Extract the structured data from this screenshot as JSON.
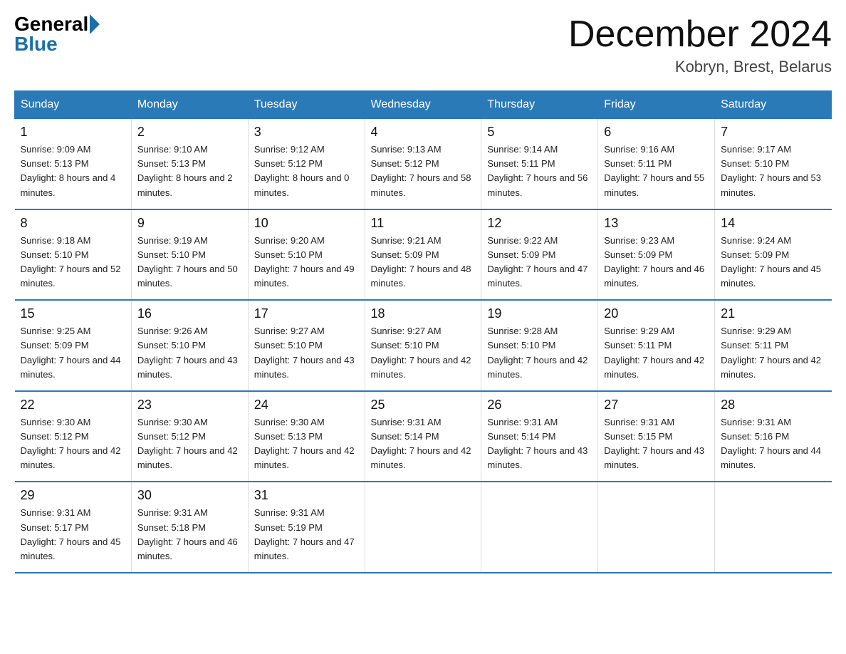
{
  "logo": {
    "general": "General",
    "blue": "Blue"
  },
  "title": {
    "month": "December 2024",
    "location": "Kobryn, Brest, Belarus"
  },
  "weekdays": [
    "Sunday",
    "Monday",
    "Tuesday",
    "Wednesday",
    "Thursday",
    "Friday",
    "Saturday"
  ],
  "weeks": [
    [
      {
        "day": "1",
        "sunrise": "Sunrise: 9:09 AM",
        "sunset": "Sunset: 5:13 PM",
        "daylight": "Daylight: 8 hours and 4 minutes."
      },
      {
        "day": "2",
        "sunrise": "Sunrise: 9:10 AM",
        "sunset": "Sunset: 5:13 PM",
        "daylight": "Daylight: 8 hours and 2 minutes."
      },
      {
        "day": "3",
        "sunrise": "Sunrise: 9:12 AM",
        "sunset": "Sunset: 5:12 PM",
        "daylight": "Daylight: 8 hours and 0 minutes."
      },
      {
        "day": "4",
        "sunrise": "Sunrise: 9:13 AM",
        "sunset": "Sunset: 5:12 PM",
        "daylight": "Daylight: 7 hours and 58 minutes."
      },
      {
        "day": "5",
        "sunrise": "Sunrise: 9:14 AM",
        "sunset": "Sunset: 5:11 PM",
        "daylight": "Daylight: 7 hours and 56 minutes."
      },
      {
        "day": "6",
        "sunrise": "Sunrise: 9:16 AM",
        "sunset": "Sunset: 5:11 PM",
        "daylight": "Daylight: 7 hours and 55 minutes."
      },
      {
        "day": "7",
        "sunrise": "Sunrise: 9:17 AM",
        "sunset": "Sunset: 5:10 PM",
        "daylight": "Daylight: 7 hours and 53 minutes."
      }
    ],
    [
      {
        "day": "8",
        "sunrise": "Sunrise: 9:18 AM",
        "sunset": "Sunset: 5:10 PM",
        "daylight": "Daylight: 7 hours and 52 minutes."
      },
      {
        "day": "9",
        "sunrise": "Sunrise: 9:19 AM",
        "sunset": "Sunset: 5:10 PM",
        "daylight": "Daylight: 7 hours and 50 minutes."
      },
      {
        "day": "10",
        "sunrise": "Sunrise: 9:20 AM",
        "sunset": "Sunset: 5:10 PM",
        "daylight": "Daylight: 7 hours and 49 minutes."
      },
      {
        "day": "11",
        "sunrise": "Sunrise: 9:21 AM",
        "sunset": "Sunset: 5:09 PM",
        "daylight": "Daylight: 7 hours and 48 minutes."
      },
      {
        "day": "12",
        "sunrise": "Sunrise: 9:22 AM",
        "sunset": "Sunset: 5:09 PM",
        "daylight": "Daylight: 7 hours and 47 minutes."
      },
      {
        "day": "13",
        "sunrise": "Sunrise: 9:23 AM",
        "sunset": "Sunset: 5:09 PM",
        "daylight": "Daylight: 7 hours and 46 minutes."
      },
      {
        "day": "14",
        "sunrise": "Sunrise: 9:24 AM",
        "sunset": "Sunset: 5:09 PM",
        "daylight": "Daylight: 7 hours and 45 minutes."
      }
    ],
    [
      {
        "day": "15",
        "sunrise": "Sunrise: 9:25 AM",
        "sunset": "Sunset: 5:09 PM",
        "daylight": "Daylight: 7 hours and 44 minutes."
      },
      {
        "day": "16",
        "sunrise": "Sunrise: 9:26 AM",
        "sunset": "Sunset: 5:10 PM",
        "daylight": "Daylight: 7 hours and 43 minutes."
      },
      {
        "day": "17",
        "sunrise": "Sunrise: 9:27 AM",
        "sunset": "Sunset: 5:10 PM",
        "daylight": "Daylight: 7 hours and 43 minutes."
      },
      {
        "day": "18",
        "sunrise": "Sunrise: 9:27 AM",
        "sunset": "Sunset: 5:10 PM",
        "daylight": "Daylight: 7 hours and 42 minutes."
      },
      {
        "day": "19",
        "sunrise": "Sunrise: 9:28 AM",
        "sunset": "Sunset: 5:10 PM",
        "daylight": "Daylight: 7 hours and 42 minutes."
      },
      {
        "day": "20",
        "sunrise": "Sunrise: 9:29 AM",
        "sunset": "Sunset: 5:11 PM",
        "daylight": "Daylight: 7 hours and 42 minutes."
      },
      {
        "day": "21",
        "sunrise": "Sunrise: 9:29 AM",
        "sunset": "Sunset: 5:11 PM",
        "daylight": "Daylight: 7 hours and 42 minutes."
      }
    ],
    [
      {
        "day": "22",
        "sunrise": "Sunrise: 9:30 AM",
        "sunset": "Sunset: 5:12 PM",
        "daylight": "Daylight: 7 hours and 42 minutes."
      },
      {
        "day": "23",
        "sunrise": "Sunrise: 9:30 AM",
        "sunset": "Sunset: 5:12 PM",
        "daylight": "Daylight: 7 hours and 42 minutes."
      },
      {
        "day": "24",
        "sunrise": "Sunrise: 9:30 AM",
        "sunset": "Sunset: 5:13 PM",
        "daylight": "Daylight: 7 hours and 42 minutes."
      },
      {
        "day": "25",
        "sunrise": "Sunrise: 9:31 AM",
        "sunset": "Sunset: 5:14 PM",
        "daylight": "Daylight: 7 hours and 42 minutes."
      },
      {
        "day": "26",
        "sunrise": "Sunrise: 9:31 AM",
        "sunset": "Sunset: 5:14 PM",
        "daylight": "Daylight: 7 hours and 43 minutes."
      },
      {
        "day": "27",
        "sunrise": "Sunrise: 9:31 AM",
        "sunset": "Sunset: 5:15 PM",
        "daylight": "Daylight: 7 hours and 43 minutes."
      },
      {
        "day": "28",
        "sunrise": "Sunrise: 9:31 AM",
        "sunset": "Sunset: 5:16 PM",
        "daylight": "Daylight: 7 hours and 44 minutes."
      }
    ],
    [
      {
        "day": "29",
        "sunrise": "Sunrise: 9:31 AM",
        "sunset": "Sunset: 5:17 PM",
        "daylight": "Daylight: 7 hours and 45 minutes."
      },
      {
        "day": "30",
        "sunrise": "Sunrise: 9:31 AM",
        "sunset": "Sunset: 5:18 PM",
        "daylight": "Daylight: 7 hours and 46 minutes."
      },
      {
        "day": "31",
        "sunrise": "Sunrise: 9:31 AM",
        "sunset": "Sunset: 5:19 PM",
        "daylight": "Daylight: 7 hours and 47 minutes."
      },
      null,
      null,
      null,
      null
    ]
  ]
}
